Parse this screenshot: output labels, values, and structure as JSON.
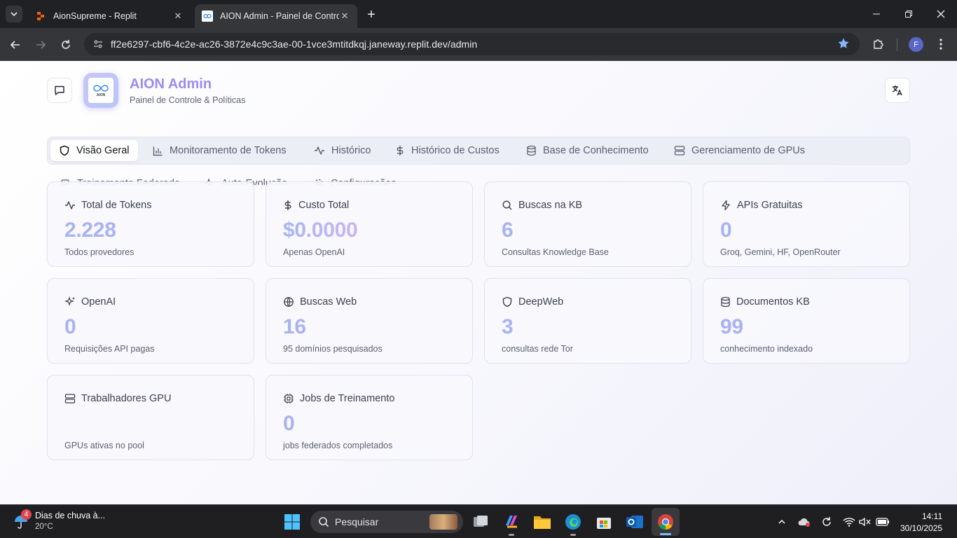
{
  "browser": {
    "tabs": [
      {
        "title": "AionSupreme - Replit"
      },
      {
        "title": "AION Admin - Painel de Controle"
      }
    ],
    "url": "ff2e6297-cbf6-4c2e-ac26-3872e4c9c3ae-00-1vce3mtitdkqj.janeway.replit.dev/admin",
    "profile_initial": "F"
  },
  "header": {
    "title": "AION Admin",
    "subtitle": "Painel de Controle & Políticas",
    "logo_text": "AION"
  },
  "nav": {
    "tabs": [
      {
        "label": "Visão Geral",
        "icon": "shield-icon",
        "active": true
      },
      {
        "label": "Monitoramento de Tokens",
        "icon": "bar-chart-icon"
      },
      {
        "label": "Histórico",
        "icon": "activity-icon"
      },
      {
        "label": "Histórico de Custos",
        "icon": "dollar-icon"
      },
      {
        "label": "Base de Conhecimento",
        "icon": "database-icon"
      },
      {
        "label": "Gerenciamento de GPUs",
        "icon": "server-icon"
      },
      {
        "label": "Treinamento Federado",
        "icon": "cpu-icon"
      },
      {
        "label": "Auto-Evolução",
        "icon": "sparkles-icon"
      },
      {
        "label": "Configurações",
        "icon": "gear-icon"
      }
    ]
  },
  "cards": [
    {
      "title": "Total de Tokens",
      "value": "2.228",
      "sub": "Todos provedores",
      "icon": "activity-icon"
    },
    {
      "title": "Custo Total",
      "value": "$0.0000",
      "sub": "Apenas OpenAI",
      "icon": "dollar-icon"
    },
    {
      "title": "Buscas na KB",
      "value": "6",
      "sub": "Consultas Knowledge Base",
      "icon": "search-icon"
    },
    {
      "title": "APIs Gratuitas",
      "value": "0",
      "sub": "Groq, Gemini, HF, OpenRouter",
      "icon": "zap-icon"
    },
    {
      "title": "OpenAI",
      "value": "0",
      "sub": "Requisições API pagas",
      "icon": "sparkles-icon"
    },
    {
      "title": "Buscas Web",
      "value": "16",
      "sub": "95 domínios pesquisados",
      "icon": "globe-icon"
    },
    {
      "title": "DeepWeb",
      "value": "3",
      "sub": "consultas rede Tor",
      "icon": "shield-icon"
    },
    {
      "title": "Documentos KB",
      "value": "99",
      "sub": "conhecimento indexado",
      "icon": "database-icon"
    },
    {
      "title": "Trabalhadores GPU",
      "value": "",
      "sub": "GPUs ativas no pool",
      "icon": "server-icon"
    },
    {
      "title": "Jobs de Treinamento",
      "value": "0",
      "sub": "jobs federados completados",
      "icon": "cpu-icon"
    }
  ],
  "taskbar": {
    "weather_badge": "4",
    "weather_title": "Dias de chuva à...",
    "weather_temp": "20°C",
    "search_label": "Pesquisar",
    "time": "14:11",
    "date": "30/10/2025"
  }
}
